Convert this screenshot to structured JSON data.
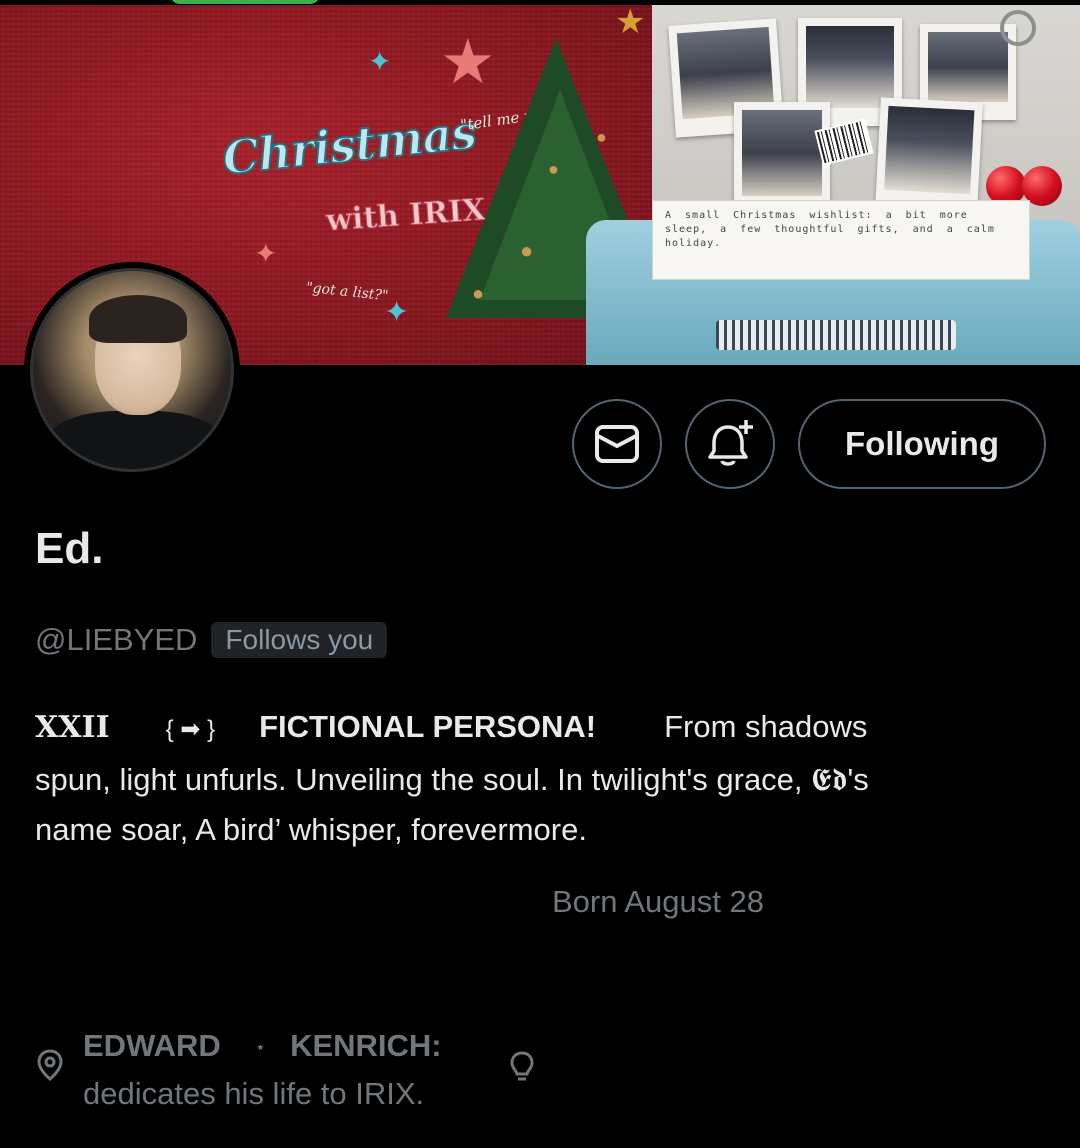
{
  "banner": {
    "title": "Christmas",
    "subtitle": "with IRIX",
    "quote_top": "\"tell me yours?\"",
    "quote_bottom": "\"got a list?\"",
    "typewriter_text": "A small Christmas wishlist: a bit more sleep, a few thoughtful gifts, and a calm holiday."
  },
  "actions": {
    "message_icon": "envelope-icon",
    "notify_icon": "bell-plus-icon",
    "following_label": "Following"
  },
  "profile": {
    "display_name": "Ed.",
    "handle": "@LIEBYED",
    "follows_you": "Follows you",
    "bio": {
      "numeral": "XXII",
      "arrow": "{ ➡ }",
      "tag": "FICTIONAL PERSONA!",
      "line1_tail": "From shadows",
      "line2": "spun, light unfurls. Unveiling the soul.  In twilight's grace, 𝕰𝖉's",
      "line3": "name soar, A bird’ whisper, forevermore."
    },
    "born": "Born August 28",
    "location": {
      "icon": "location-pin-icon",
      "first": "EDWARD",
      "separator": "⋆",
      "second": "KENRICH:",
      "line2": "dedicates  his life to IRIX.",
      "trail_icon": "lightbulb-icon"
    }
  }
}
